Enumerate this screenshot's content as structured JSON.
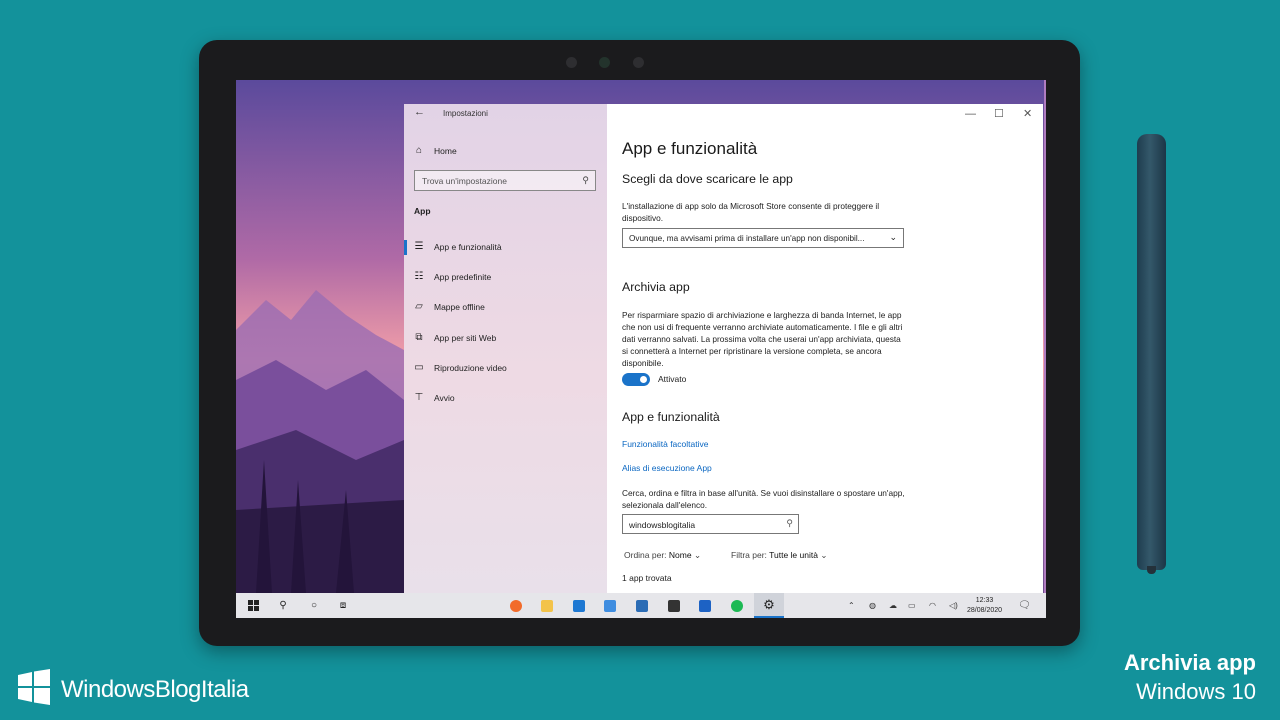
{
  "window": {
    "title": "Impostazioni",
    "minimize": "—",
    "maximize": "☐",
    "close": "✕"
  },
  "sidebar": {
    "home": "Home",
    "search_placeholder": "Trova un'impostazione",
    "section": "App",
    "items": [
      {
        "label": "App e funzionalità",
        "icon": "list-icon"
      },
      {
        "label": "App predefinite",
        "icon": "defaults-icon"
      },
      {
        "label": "Mappe offline",
        "icon": "map-icon"
      },
      {
        "label": "App per siti Web",
        "icon": "web-apps-icon"
      },
      {
        "label": "Riproduzione video",
        "icon": "video-icon"
      },
      {
        "label": "Avvio",
        "icon": "startup-icon"
      }
    ]
  },
  "main": {
    "title": "App e funzionalità",
    "install_heading": "Scegli da dove scaricare le app",
    "install_desc": "L'installazione di app solo da Microsoft Store consente di proteggere il dispositivo.",
    "install_select": "Ovunque, ma avvisami prima di installare un'app non disponibil...",
    "archive_heading": "Archivia app",
    "archive_desc": "Per risparmiare spazio di archiviazione e larghezza di banda Internet, le app che non usi di frequente verranno archiviate automaticamente. I file e gli altri dati verranno salvati. La prossima volta che userai un'app archiviata, questa si connetterà a Internet per ripristinare la versione completa, se ancora disponibile.",
    "archive_toggle": "Attivato",
    "apps_heading": "App e funzionalità",
    "link_optional": "Funzionalità facoltative",
    "link_alias": "Alias di esecuzione App",
    "filter_desc": "Cerca, ordina e filtra in base all'unità. Se vuoi disinstallare o spostare un'app, selezionala dall'elenco.",
    "search_value": "windowsblogitalia",
    "sort_label": "Ordina per:",
    "sort_value": "Nome",
    "filter_label": "Filtra per:",
    "filter_value": "Tutte le unità",
    "count": "1 app trovata"
  },
  "taskbar": {
    "time": "12:33",
    "date": "28/08/2020"
  },
  "brand": "WindowsBlogItalia",
  "caption": {
    "title": "Archivia app",
    "subtitle": "Windows 10"
  },
  "colors": {
    "background": "#13929b",
    "accent": "#1a73c9",
    "link": "#0b67c2"
  }
}
